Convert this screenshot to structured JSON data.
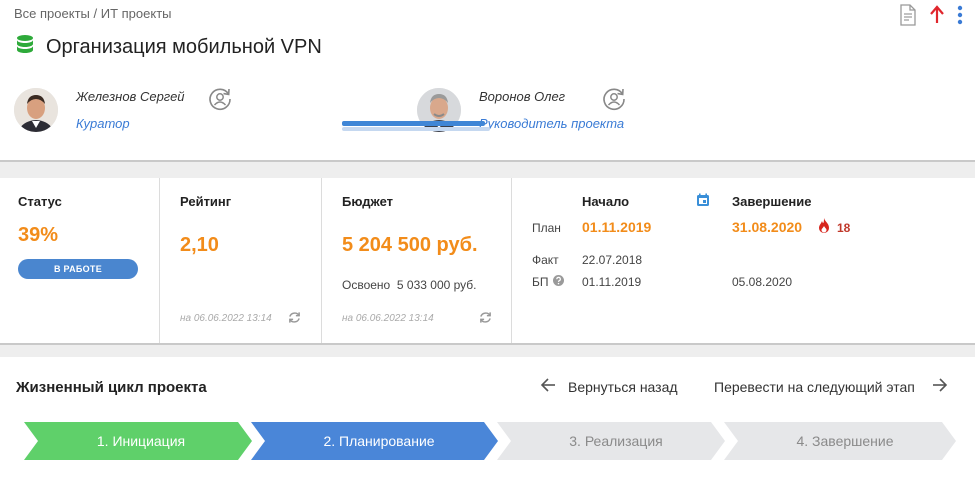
{
  "breadcrumb": {
    "root": "Все проекты",
    "separator": "/",
    "current": "ИТ проекты"
  },
  "project": {
    "title": "Организация мобильной VPN",
    "icon": "database-icon",
    "icon_color": "#2eaa3a"
  },
  "top_actions": {
    "report_icon": "document-icon",
    "up_icon": "arrow-up-icon",
    "up_color": "#e0262d",
    "menu_icon": "kebab-menu-icon",
    "menu_color": "#3a7bd5"
  },
  "people": [
    {
      "name": "Железнов Сергей",
      "role": "Куратор"
    },
    {
      "name": "Воронов Олег",
      "role": "Руководитель проекта"
    }
  ],
  "status": {
    "label": "Статус",
    "percent": "39%",
    "badge": "В РАБОТЕ"
  },
  "rating": {
    "label": "Рейтинг",
    "value": "2,10",
    "updated": "на 06.06.2022 13:14"
  },
  "budget": {
    "label": "Бюджет",
    "value": "5 204 500 руб.",
    "spent_label": "Освоено",
    "spent_value": "5 033 000 руб.",
    "spent_fraction": 0.967,
    "updated": "на 06.06.2022 13:14"
  },
  "dates": {
    "start_header": "Начало",
    "end_header": "Завершение",
    "rows": [
      {
        "label": "План",
        "start": "01.11.2019",
        "end": "31.08.2020"
      },
      {
        "label": "Факт",
        "start": "22.07.2018",
        "end": ""
      },
      {
        "label": "БП",
        "start": "01.11.2019",
        "end": "05.08.2020"
      }
    ],
    "overdue_days": "18",
    "accent": "#f28c1a",
    "overdue_color": "#c0392b"
  },
  "lifecycle": {
    "title": "Жизненный цикл проекта",
    "back_label": "Вернуться назад",
    "next_label": "Перевести на следующий этап",
    "stages": [
      {
        "label": "1. Инициация",
        "color": "#5fd06a",
        "text_color": "#ffffff"
      },
      {
        "label": "2. Планирование",
        "color": "#4a86d8",
        "text_color": "#ffffff"
      },
      {
        "label": "3. Реализация",
        "color": "#e6e7e9",
        "text_color": "#8a8a8a"
      },
      {
        "label": "4. Завершение",
        "color": "#e6e7e9",
        "text_color": "#8a8a8a"
      }
    ]
  }
}
